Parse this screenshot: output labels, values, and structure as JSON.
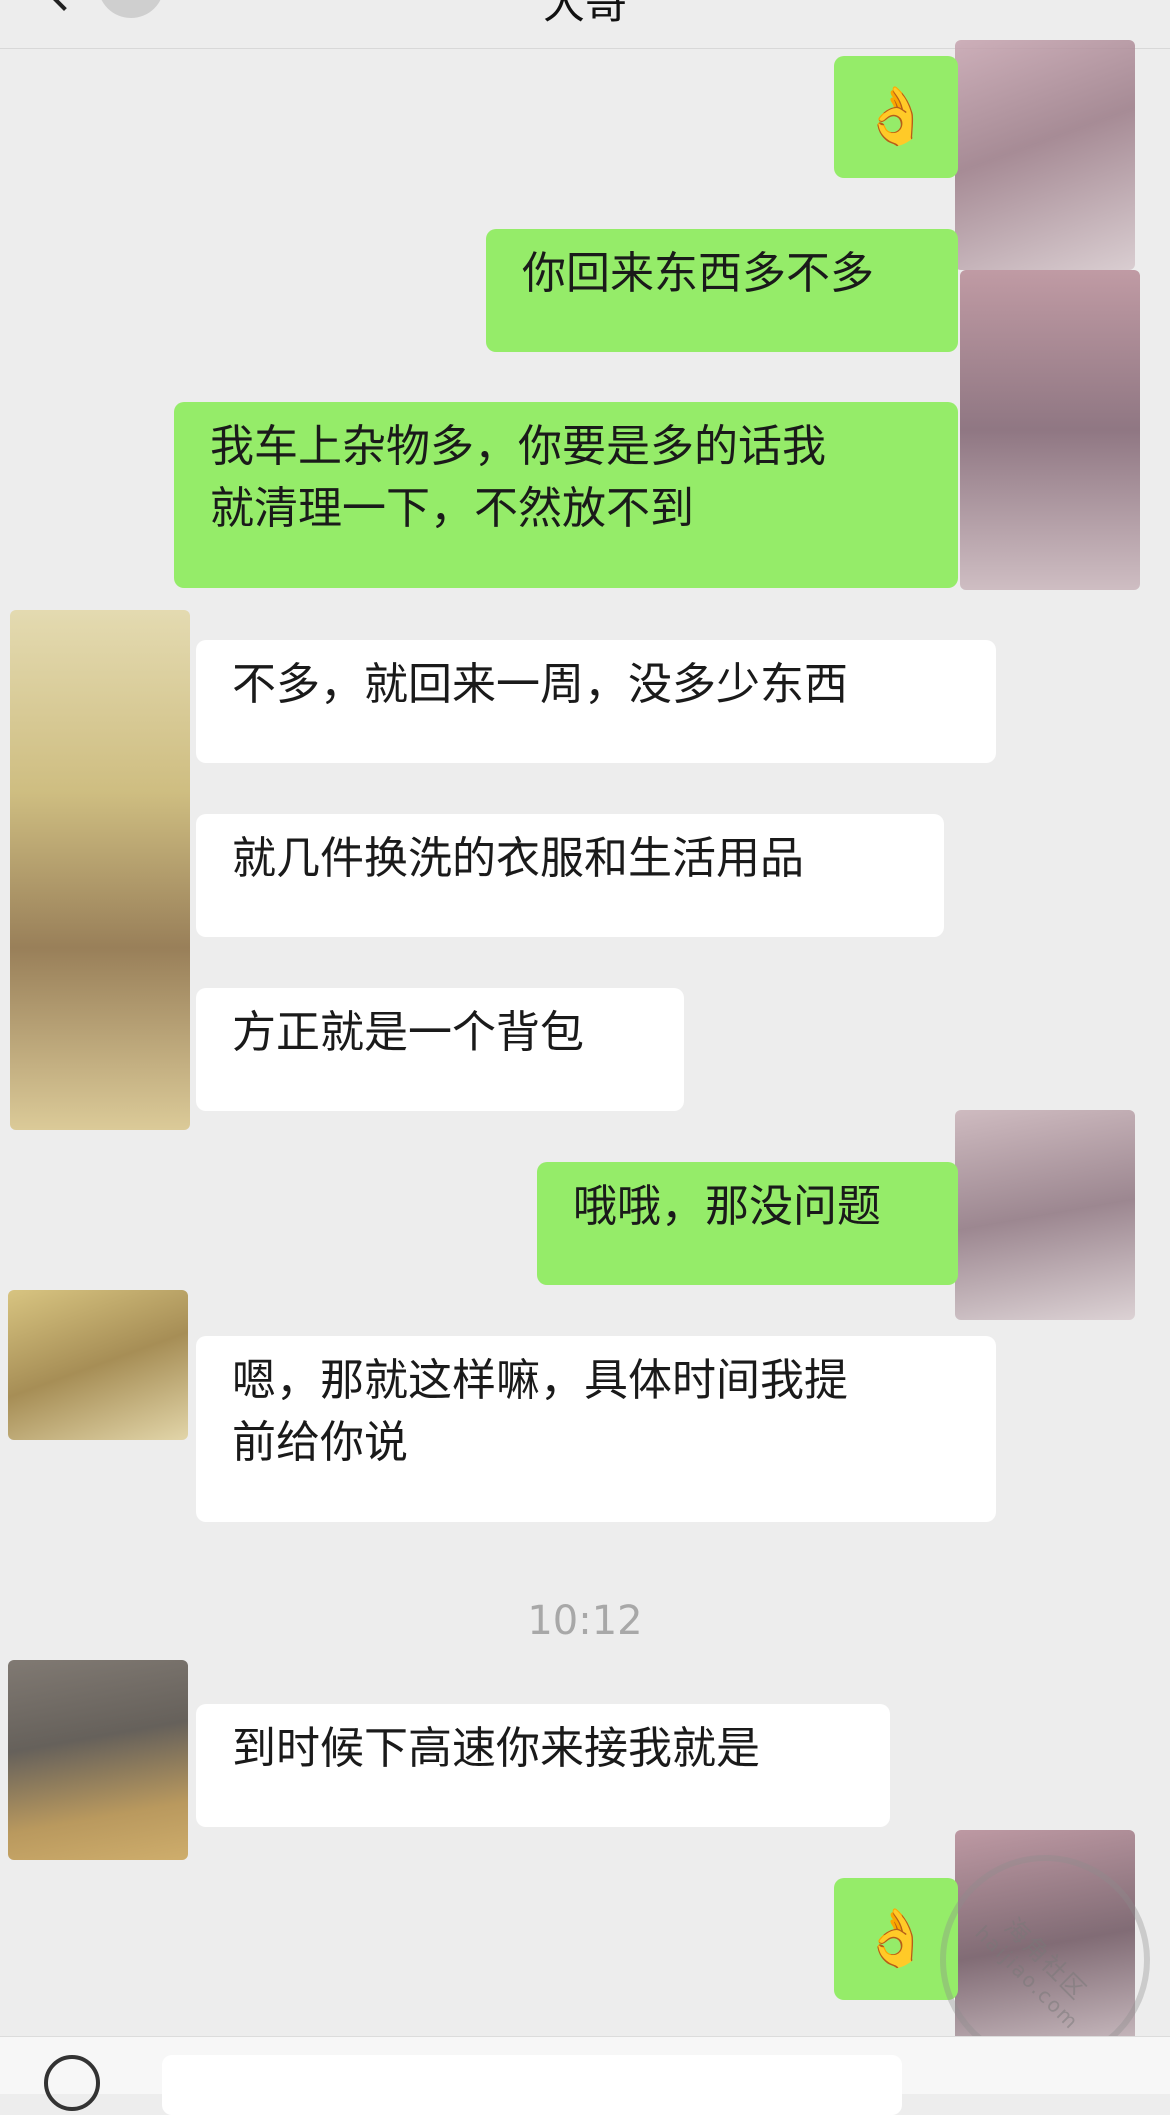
{
  "header": {
    "title": "大哥"
  },
  "messages": [
    {
      "side": "right",
      "type": "emoji",
      "text": "👌"
    },
    {
      "side": "right",
      "type": "text",
      "text": "你回来东西多不多"
    },
    {
      "side": "right",
      "type": "text",
      "line1": "我车上杂物多，你要是多的话我",
      "line2": "就清理一下，不然放不到"
    },
    {
      "side": "left",
      "type": "text",
      "text": "不多，就回来一周，没多少东西"
    },
    {
      "side": "left",
      "type": "text",
      "text": "就几件换洗的衣服和生活用品"
    },
    {
      "side": "left",
      "type": "text",
      "text": "方正就是一个背包"
    },
    {
      "side": "right",
      "type": "text",
      "text": "哦哦，那没问题"
    },
    {
      "side": "left",
      "type": "text",
      "line1": "嗯，那就这样嘛，具体时间我提",
      "line2": "前给你说"
    },
    {
      "side": "left",
      "type": "text",
      "text": "到时候下高速你来接我就是"
    },
    {
      "side": "right",
      "type": "emoji",
      "text": "👌"
    }
  ],
  "timestamp": "10:12",
  "watermark": {
    "line1": "海角社区",
    "line2": "haijiao.com"
  },
  "colors": {
    "background": "#ededed",
    "sent_bubble": "#95ec69",
    "received_bubble": "#ffffff",
    "timestamp": "#a8a8a8"
  }
}
